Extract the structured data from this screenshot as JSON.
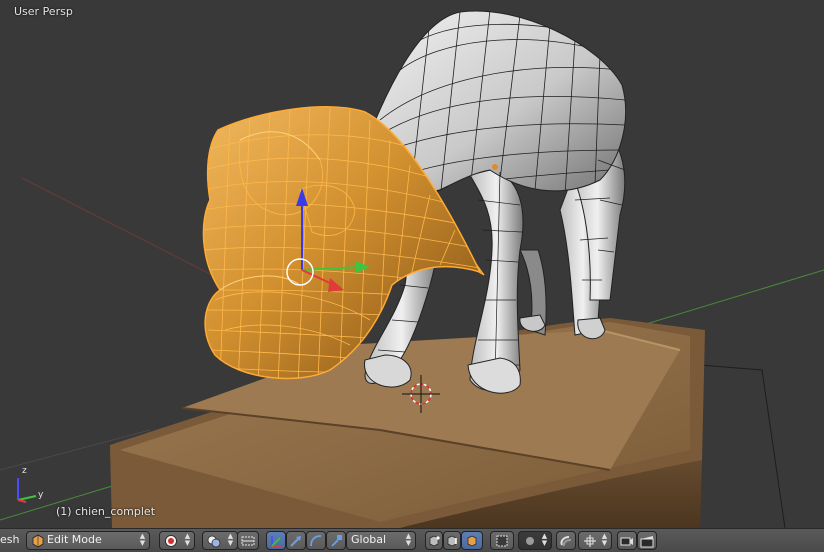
{
  "viewport": {
    "view_name": "User Persp",
    "object_info": "(1) chien_complet"
  },
  "header": {
    "editor_type_label": "esh",
    "mode_label": "Edit Mode",
    "orientation_label": "Global"
  },
  "icons": [
    "mode-icon",
    "pivot-icon",
    "shading-icon",
    "manipulator-icon",
    "translate-icon",
    "rotate-icon",
    "scale-icon",
    "vertex-select-icon",
    "edge-select-icon",
    "face-select-icon",
    "limit-selection-icon",
    "proportional-edit-icon",
    "snap-icon",
    "snap-target-icon",
    "render-icon",
    "animation-icon"
  ],
  "colors": {
    "viewport_bg": "#393939",
    "selected_wire": "#ffaa33",
    "selected_mesh": "#d98d2c",
    "base_wood": "#8a6a45",
    "axis_x": "#e03a3a",
    "axis_y": "#3fc43f",
    "axis_z": "#3a3ae6"
  }
}
